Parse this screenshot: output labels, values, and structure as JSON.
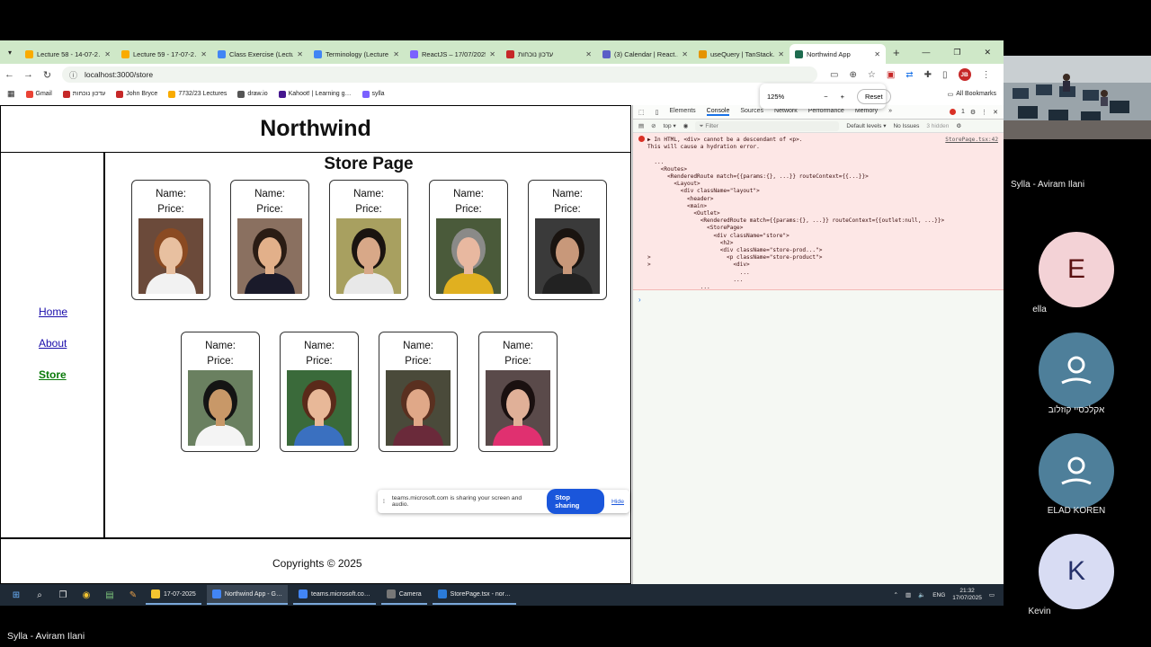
{
  "browser": {
    "tabs": [
      {
        "title": "Lecture 58 - 14-07-2…",
        "color": "#f9ab00"
      },
      {
        "title": "Lecture 59 - 17-07-2…",
        "color": "#f9ab00"
      },
      {
        "title": "Class Exercise (Lectu…",
        "color": "#4285f4"
      },
      {
        "title": "Terminology (Lecture…",
        "color": "#4285f4"
      },
      {
        "title": "ReactJS – 17/07/2025",
        "color": "#7b61ff"
      },
      {
        "title": "עדכון נוכחות",
        "color": "#c62828"
      },
      {
        "title": "(3) Calendar | React…",
        "color": "#5b5fc7"
      },
      {
        "title": "useQuery | TanStack…",
        "color": "#e59400"
      },
      {
        "title": "Northwind App",
        "color": "#1e6b4f"
      }
    ],
    "url": "localhost:3000/store",
    "bookmarks": [
      "Gmail",
      "עדכון נוכחות",
      "John Bryce",
      "7732/23 Lectures",
      "draw.io",
      "Kahoot! | Learning g…",
      "sylla"
    ],
    "all_bookmarks": "All Bookmarks",
    "zoom": {
      "level": "125%",
      "minus": "−",
      "plus": "+",
      "reset": "Reset"
    }
  },
  "app": {
    "title": "Northwind",
    "nav": [
      {
        "label": "Home",
        "active": false
      },
      {
        "label": "About",
        "active": false
      },
      {
        "label": "Store",
        "active": true
      }
    ],
    "page_title": "Store Page",
    "card_name_label": "Name:",
    "card_price_label": "Price:",
    "products": [
      {
        "bg": "#6b4a3a",
        "skin": "#e8c0a0",
        "hair": "#8a4a22",
        "shirt": "#f2f2f2"
      },
      {
        "bg": "#8a7060",
        "skin": "#e2b08a",
        "hair": "#2a1c14",
        "shirt": "#1a1a2a"
      },
      {
        "bg": "#a8a060",
        "skin": "#d8a888",
        "hair": "#1a1410",
        "shirt": "#e8e8e8"
      },
      {
        "bg": "#4a5a3a",
        "skin": "#e8b8a0",
        "hair": "#8a8a88",
        "shirt": "#e0b020"
      },
      {
        "bg": "#3a3a3a",
        "skin": "#c8987a",
        "hair": "#1a1410",
        "shirt": "#222222"
      },
      {
        "bg": "#6a8060",
        "skin": "#c89868",
        "hair": "#141414",
        "shirt": "#f4f4f4"
      },
      {
        "bg": "#3a6a3a",
        "skin": "#e8b898",
        "hair": "#5a2a1a",
        "shirt": "#3a70c0"
      },
      {
        "bg": "#4a4a3a",
        "skin": "#e0a888",
        "hair": "#5a3020",
        "shirt": "#6a2a3a"
      },
      {
        "bg": "#5a4a4a",
        "skin": "#e0b098",
        "hair": "#1a1010",
        "shirt": "#e03070"
      }
    ],
    "footer": "Copyrights © 2025"
  },
  "share_bar": {
    "text": "teams.microsoft.com is sharing your screen and audio.",
    "stop": "Stop sharing",
    "hide": "Hide"
  },
  "devtools": {
    "tabs": [
      "Elements",
      "Console",
      "Sources",
      "Network",
      "Performance",
      "Memory",
      "»"
    ],
    "active_tab": "Console",
    "error_count": "1",
    "context": "top ▾",
    "filter_placeholder": "Filter",
    "levels": "Default levels ▾",
    "issues": "No Issues",
    "hidden": "3 hidden",
    "error_source": "StorePage.tsx:42",
    "error_lines": [
      "▶ In HTML, <div> cannot be a descendant of <p>.",
      "This will cause a hydration error.",
      "",
      "  ...",
      "    <Routes>",
      "      <RenderedRoute match={{params:{}, ...}} routeContext={{...}}>",
      "        <Layout>",
      "          <div className=\"layout\">",
      "            <header>",
      "            <main>",
      "              <Outlet>",
      "                <RenderedRoute match={{params:{}, ...}} routeContext={{outlet:null, ...}}>",
      "                  <StorePage>",
      "                    <div className=\"store\">",
      "                      <h2>",
      "                      <div className=\"store-prod...\">",
      ">                       <p className=\"store-product\">",
      ">                         <div>",
      "                            ...",
      "                          ...",
      "                ..."
    ],
    "prompt": "›"
  },
  "taskbar": {
    "items": [
      {
        "label": "17-07-2025",
        "color": "#f4c430",
        "active": false
      },
      {
        "label": "Northwind App - G…",
        "color": "#4285f4",
        "active": true
      },
      {
        "label": "teams.microsoft.co…",
        "color": "#4285f4",
        "active": false
      },
      {
        "label": "Camera",
        "color": "#777777",
        "active": false
      },
      {
        "label": "StorePage.tsx - nor…",
        "color": "#2b7bd8",
        "active": false
      }
    ],
    "lang": "ENG",
    "time": "21:32",
    "date": "17/07/2025"
  },
  "teams": {
    "presenter": "Sylla - Aviram Ilani",
    "participants": [
      {
        "initial": "E",
        "name": "ella",
        "bg": "#f3d2d6",
        "fg": "#5a1010"
      },
      {
        "initial": "",
        "name": "אקלכסיי קוזלוב",
        "bg": "#4e7f9a",
        "fg": "#ffffff"
      },
      {
        "initial": "",
        "name": "ELAD KOREN",
        "bg": "#4e7f9a",
        "fg": "#ffffff"
      },
      {
        "initial": "K",
        "name": "Kevin",
        "bg": "#d8dcf3",
        "fg": "#25306a"
      }
    ],
    "self_name": "Sylla - Aviram Ilani"
  }
}
